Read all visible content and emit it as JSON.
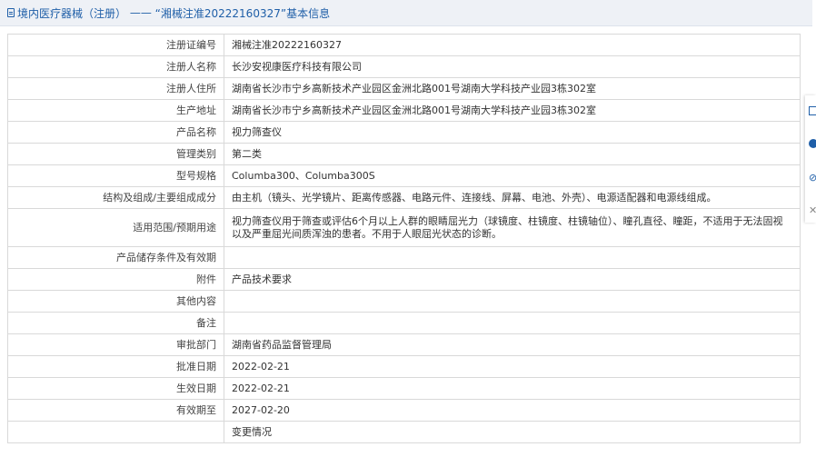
{
  "header": {
    "section": "境内医疗器械（注册）",
    "separator": " —— ",
    "record_title": "“湘械注准20222160327”基本信息"
  },
  "rows": [
    {
      "label": "注册证编号",
      "value": "湘械注准20222160327"
    },
    {
      "label": "注册人名称",
      "value": "长沙安视康医疗科技有限公司"
    },
    {
      "label": "注册人住所",
      "value": "湖南省长沙市宁乡高新技术产业园区金洲北路001号湖南大学科技产业园3栋302室"
    },
    {
      "label": "生产地址",
      "value": "湖南省长沙市宁乡高新技术产业园区金洲北路001号湖南大学科技产业园3栋302室"
    },
    {
      "label": "产品名称",
      "value": "视力筛查仪"
    },
    {
      "label": "管理类别",
      "value": "第二类"
    },
    {
      "label": "型号规格",
      "value": "Columba300、Columba300S"
    },
    {
      "label": "结构及组成/主要组成成分",
      "value": "由主机（镜头、光学镜片、距离传感器、电路元件、连接线、屏幕、电池、外壳）、电源适配器和电源线组成。"
    },
    {
      "label": "适用范围/预期用途",
      "value": "视力筛查仪用于筛查或评估6个月以上人群的眼睛屈光力（球镜度、柱镜度、柱镜轴位）、瞳孔直径、瞳距，不适用于无法固视以及严重屈光间质浑浊的患者。不用于人眼屈光状态的诊断。"
    },
    {
      "label": "产品储存条件及有效期",
      "value": ""
    },
    {
      "label": "附件",
      "value": "产品技术要求"
    },
    {
      "label": "其他内容",
      "value": ""
    },
    {
      "label": "备注",
      "value": ""
    },
    {
      "label": "审批部门",
      "value": "湖南省药品监督管理局"
    },
    {
      "label": "批准日期",
      "value": "2022-02-21"
    },
    {
      "label": "生效日期",
      "value": "2022-02-21"
    },
    {
      "label": "有效期至",
      "value": "2027-02-20"
    },
    {
      "label": "",
      "value": "变更情况"
    }
  ],
  "colors": {
    "link": "#1f5fa8",
    "border": "#d9d9d9",
    "header_bg": "#eef1f6"
  },
  "side_rail": {
    "icons": [
      "document-icon",
      "info-dot-icon",
      "link-icon",
      "close-icon"
    ]
  }
}
